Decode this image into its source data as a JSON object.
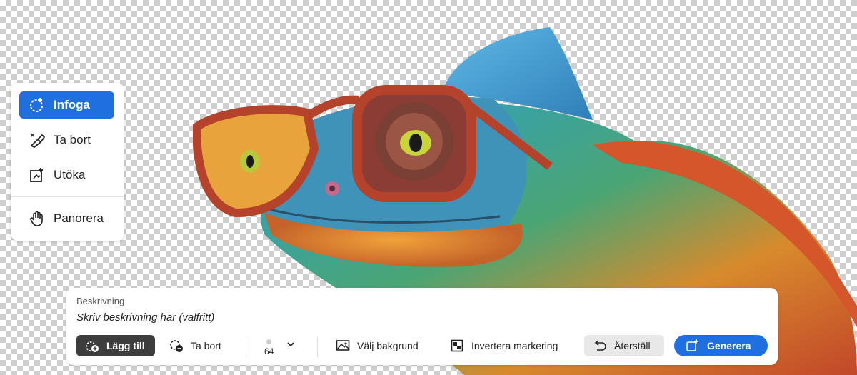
{
  "tools": [
    {
      "label": "Infoga",
      "icon": "insert-icon",
      "active": true
    },
    {
      "label": "Ta bort",
      "icon": "remove-brush-icon",
      "active": false
    },
    {
      "label": "Utöka",
      "icon": "expand-icon",
      "active": false
    },
    {
      "label": "Panorera",
      "icon": "hand-icon",
      "active": false
    }
  ],
  "bar": {
    "description_label": "Beskrivning",
    "description_placeholder": "Skriv beskrivning här (valfritt)",
    "add_label": "Lägg till",
    "remove_label": "Ta bort",
    "brush_size": "64",
    "choose_background_label": "Välj bakgrund",
    "invert_selection_label": "Invertera markering",
    "reset_label": "Återställ",
    "generate_label": "Generera"
  },
  "colors": {
    "accent": "#1f6fe0",
    "dark_button": "#3d3d3d",
    "reset_bg": "#e8e8e8"
  }
}
